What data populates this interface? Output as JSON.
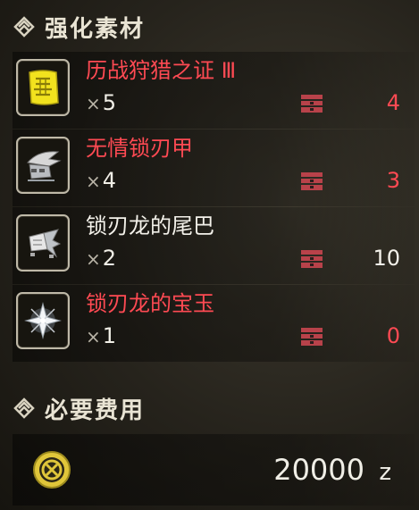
{
  "sections": {
    "materials_title": "强化素材",
    "cost_title": "必要费用"
  },
  "materials": [
    {
      "name": "历战狩猎之证 Ⅲ",
      "owned": "5",
      "box": "4",
      "name_color": "#ff4a53",
      "box_color": "#ff4a53",
      "icon": "certificate-icon"
    },
    {
      "name": "无情锁刃甲",
      "owned": "4",
      "box": "3",
      "name_color": "#ff4a53",
      "box_color": "#ff4a53",
      "icon": "armor-shell-icon"
    },
    {
      "name": "锁刃龙的尾巴",
      "owned": "2",
      "box": "10",
      "name_color": "#f3f1ea",
      "box_color": "#f3f1ea",
      "icon": "tail-icon"
    },
    {
      "name": "锁刃龙的宝玉",
      "owned": "1",
      "box": "0",
      "name_color": "#ff4a53",
      "box_color": "#ff4a53",
      "icon": "gem-icon"
    }
  ],
  "multiply_sign": "×",
  "cost": {
    "value": "20000",
    "unit": "z"
  },
  "colors": {
    "insufficient": "#ff4a53",
    "normal": "#f3f1ea",
    "box_icon": "#b8424a",
    "coin": "#e0c63a"
  }
}
